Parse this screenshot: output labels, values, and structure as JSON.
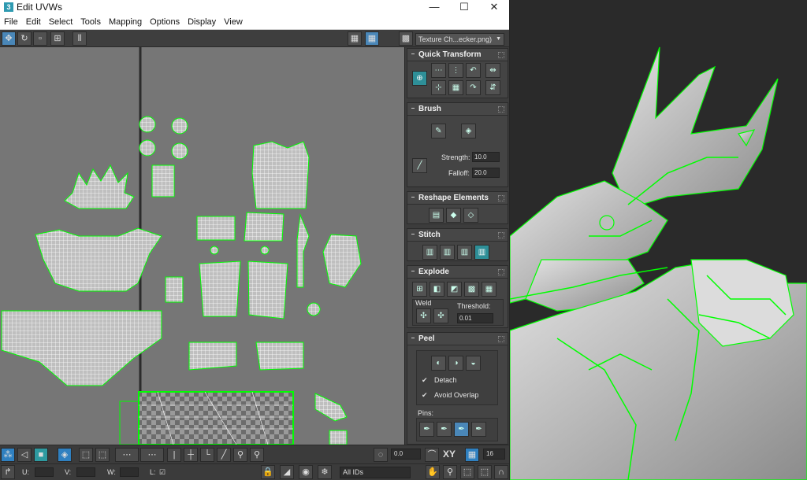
{
  "window": {
    "title": "Edit UVWs",
    "app_icon_label": "3"
  },
  "window_controls": {
    "minimize": "—",
    "maximize": "☐",
    "close": "✕"
  },
  "menu": [
    "File",
    "Edit",
    "Select",
    "Tools",
    "Mapping",
    "Options",
    "Display",
    "View"
  ],
  "toolbar": {
    "uv_label": "U V",
    "texture_dropdown": "Texture Ch...ecker.png)",
    "dropdown_arrow": "▼"
  },
  "panels": {
    "quick_transform": {
      "title": "Quick Transform"
    },
    "brush": {
      "title": "Brush",
      "strength_label": "Strength:",
      "strength_value": "10.0",
      "falloff_label": "Falloff:",
      "falloff_value": "20.0"
    },
    "reshape": {
      "title": "Reshape Elements"
    },
    "stitch": {
      "title": "Stitch"
    },
    "explode": {
      "title": "Explode",
      "weld_label": "Weld",
      "threshold_label": "Threshold:",
      "threshold_value": "0.01"
    },
    "peel": {
      "title": "Peel",
      "detach_label": "Detach",
      "avoid_overlap_label": "Avoid Overlap",
      "pins_label": "Pins:"
    }
  },
  "bottom_toolbar": {
    "angle_value": "0.0",
    "xy_label": "XY",
    "grid_value": "16"
  },
  "status_bar": {
    "u_label": "U:",
    "v_label": "V:",
    "w_label": "W:",
    "l_label": "L:",
    "ids_dropdown": "All IDs"
  },
  "colors": {
    "accent": "#2f80c0",
    "teal": "#2e8f98",
    "uv_wire": "#ffffff",
    "seam": "#00ff00"
  }
}
